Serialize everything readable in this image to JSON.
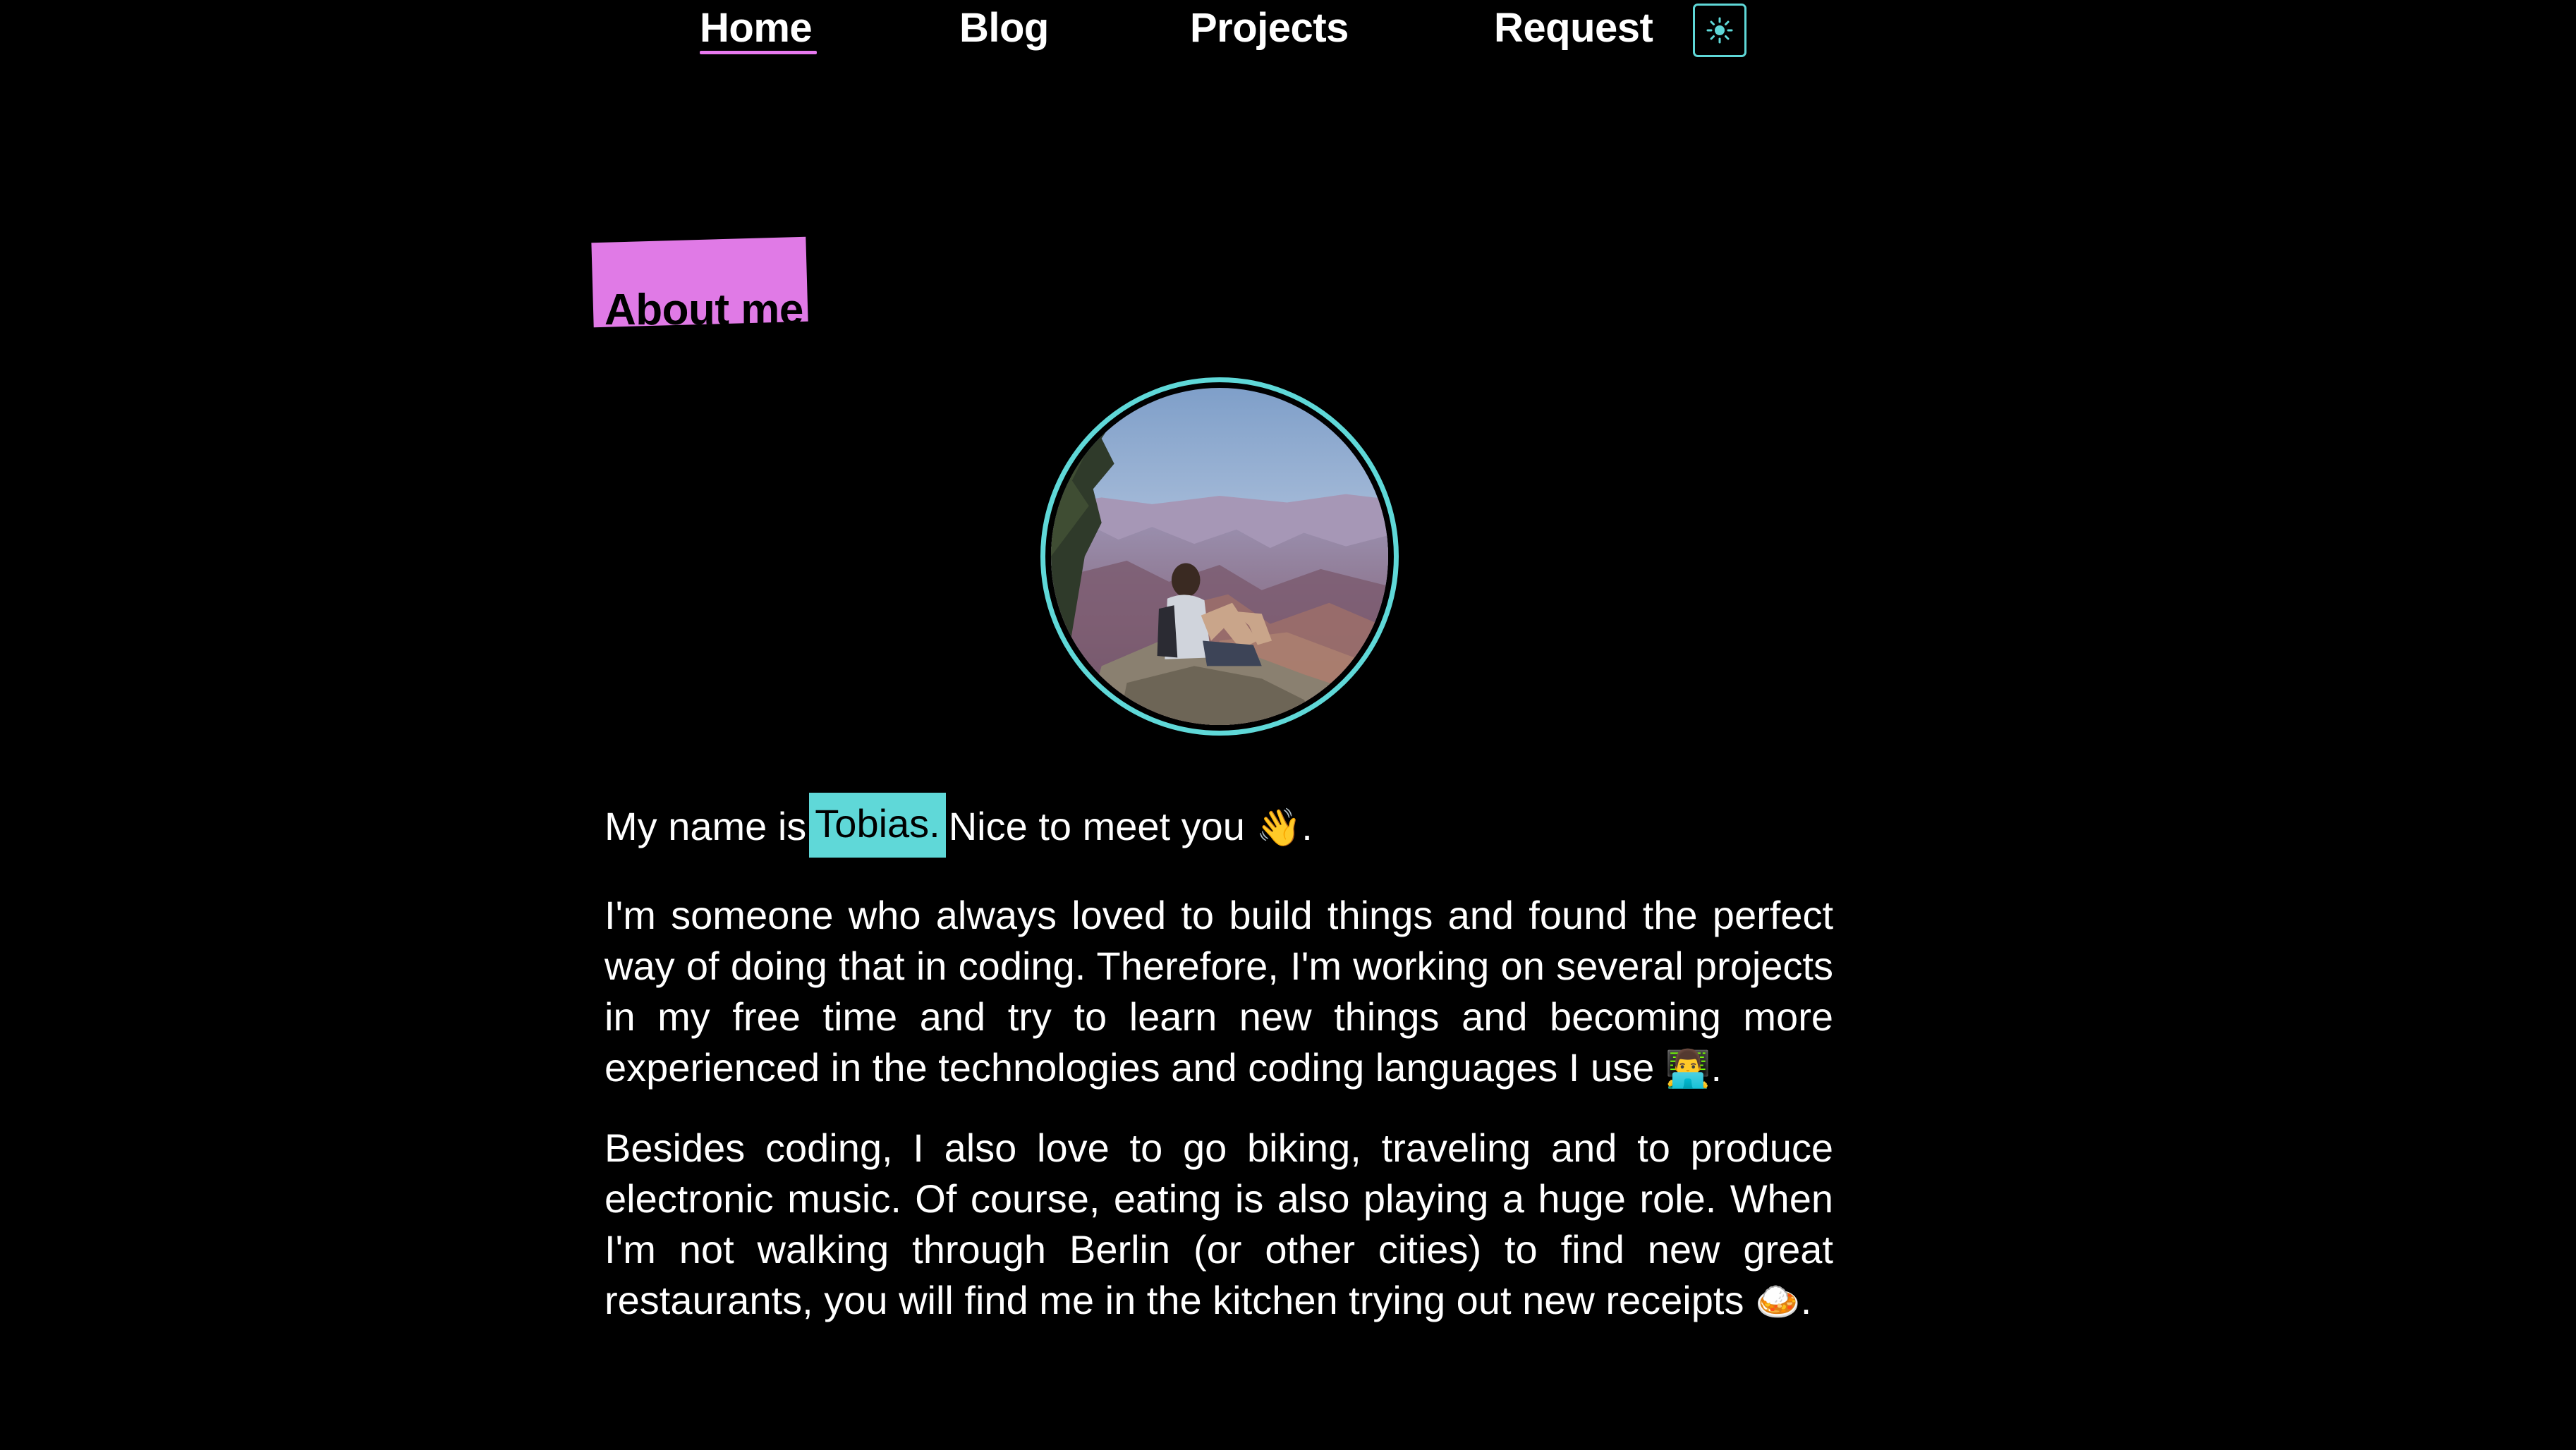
{
  "nav": {
    "home": "Home",
    "blog": "Blog",
    "projects": "Projects",
    "request": "Request",
    "theme_toggle_icon": "sun-icon"
  },
  "about": {
    "title": "About me"
  },
  "intro": {
    "prefix": "My name is",
    "name": "Tobias.",
    "suffix": "Nice to meet you",
    "wave_emoji": "👋",
    "end": "."
  },
  "paragraphs": {
    "p1_text": "I'm someone who always loved to build things and found the perfect way of doing that in coding. Therefore, I'm working on several projects in my free time and try to learn new things and becoming more experienced in the technologies and coding languages I use",
    "p1_emoji": "👨‍💻",
    "p1_end": ".",
    "p2_text": "Besides coding, I also love to go biking, traveling and to produce electronic music. Of course, eating is also playing a huge role. When I'm not walking through Berlin (or other cities) to find new great restaurants, you will find me in the kitchen trying out new receipts",
    "p2_emoji": "🍛",
    "p2_end": "."
  },
  "colors": {
    "background": "#000000",
    "accent_pink": "#e07ae6",
    "accent_cyan": "#5fd8d8",
    "text": "#ffffff"
  }
}
